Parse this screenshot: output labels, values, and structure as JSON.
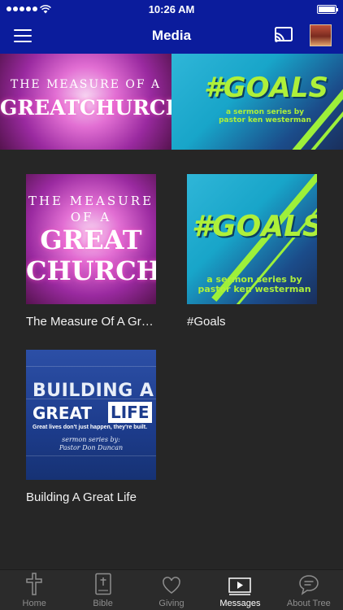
{
  "status_bar": {
    "time": "10:26 AM"
  },
  "header": {
    "title": "Media",
    "menu_icon": "hamburger-icon",
    "cast_icon": "cast-icon",
    "avatar_icon": "avatar"
  },
  "featured": [
    {
      "art": {
        "line1": "THE MEASURE OF A",
        "line2": "GREATCHURCH"
      }
    },
    {
      "art": {
        "headline": "#GOALS",
        "sub1": "a sermon series by",
        "sub2": "pastor ken westerman"
      }
    }
  ],
  "series": [
    {
      "label": "The Measure Of A Great Church",
      "art": {
        "line1": "THE MEASURE",
        "line2": "OF A",
        "line3": "GREAT",
        "line4": "CHURCH"
      }
    },
    {
      "label": "#Goals",
      "art": {
        "headline": "#GOALS",
        "sub1": "a sermon series by",
        "sub2": "pastor ken westerman"
      }
    },
    {
      "label": "Building A Great Life",
      "art": {
        "line1": "BUILDING A",
        "great": "GREAT",
        "life": "LIFE",
        "tagline": "Great lives don't just happen, they're built.",
        "series1": "sermon series by:",
        "series2": "Pastor Don Duncan"
      }
    }
  ],
  "tabs": [
    {
      "label": "Home",
      "icon": "cross-icon"
    },
    {
      "label": "Bible",
      "icon": "bible-icon"
    },
    {
      "label": "Giving",
      "icon": "heart-icon"
    },
    {
      "label": "Messages",
      "icon": "play-icon"
    },
    {
      "label": "About Tree",
      "icon": "chat-icon"
    }
  ],
  "colors": {
    "header_bg": "#0b1c9c",
    "page_bg": "#262626",
    "tabbar_bg": "#2b2b2b",
    "tab_active": "#ffffff",
    "tab_inactive": "#8e8e8e",
    "goals_green": "#aef03a"
  }
}
